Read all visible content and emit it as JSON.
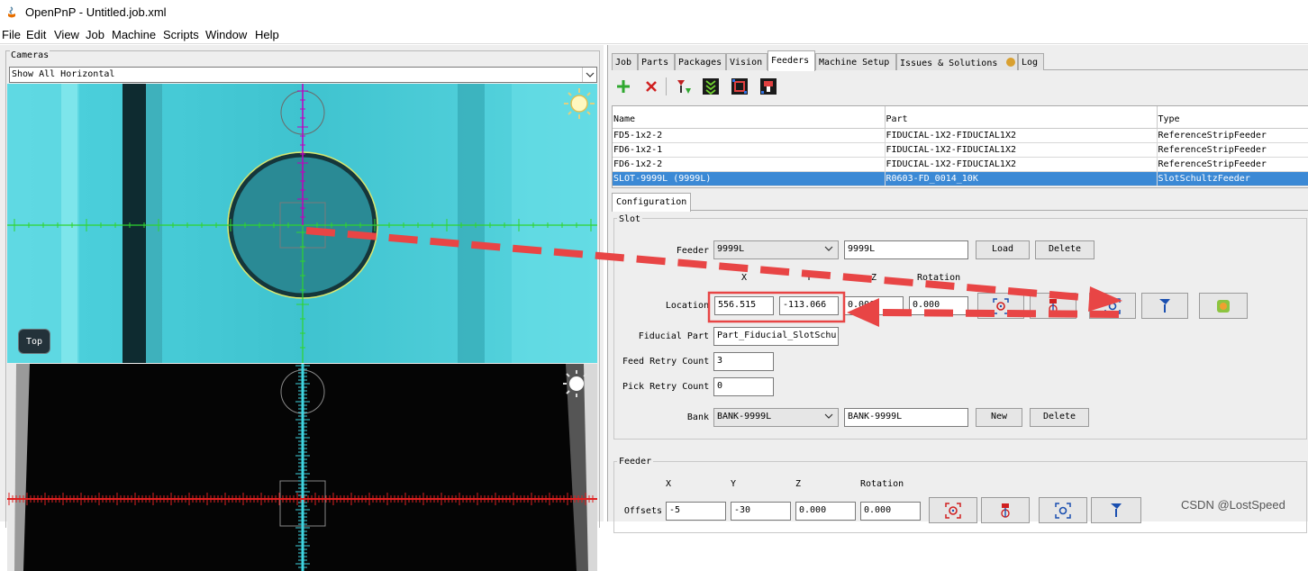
{
  "window": {
    "title": "OpenPnP - Untitled.job.xml"
  },
  "menu": [
    "File",
    "Edit",
    "View",
    "Job",
    "Machine",
    "Scripts",
    "Window",
    "Help"
  ],
  "cameras": {
    "legend": "Cameras",
    "selected": "Show All Horizontal",
    "top_badge": "Top"
  },
  "tabs": [
    "Job",
    "Parts",
    "Packages",
    "Vision",
    "Feeders",
    "Machine Setup",
    "Issues & Solutions",
    "Log"
  ],
  "active_tab": "Feeders",
  "table": {
    "columns": [
      "Name",
      "Part",
      "Type"
    ],
    "rows": [
      [
        "FD5-1x2-2",
        "FIDUCIAL-1X2-FIDUCIAL1X2",
        "ReferenceStripFeeder"
      ],
      [
        "FD6-1x2-1",
        "FIDUCIAL-1X2-FIDUCIAL1X2",
        "ReferenceStripFeeder"
      ],
      [
        "FD6-1x2-2",
        "FIDUCIAL-1X2-FIDUCIAL1X2",
        "ReferenceStripFeeder"
      ],
      [
        "SLOT-9999L (9999L)",
        "R0603-FD_0014_10K",
        "SlotSchultzFeeder"
      ]
    ],
    "selected_row": 3
  },
  "config": {
    "tab": "Configuration",
    "slot": {
      "legend": "Slot",
      "feeder_label": "Feeder",
      "feeder_combo": "9999L",
      "feeder_name": "9999L",
      "load": "Load",
      "delete": "Delete",
      "col_x": "X",
      "col_y": "Y",
      "col_z": "Z",
      "col_rotation": "Rotation",
      "location_label": "Location",
      "loc_x": "556.515",
      "loc_y": "-113.066",
      "loc_z": "0.000",
      "loc_rot": "0.000",
      "fiducial_label": "Fiducial Part",
      "fiducial_value": "Part_Fiducial_SlotSchu",
      "feed_retry_label": "Feed Retry Count",
      "feed_retry_value": "3",
      "pick_retry_label": "Pick Retry Count",
      "pick_retry_value": "0",
      "bank_label": "Bank",
      "bank_combo": "BANK-9999L",
      "bank_name": "BANK-9999L",
      "new": "New",
      "bank_delete": "Delete"
    },
    "feeder": {
      "legend": "Feeder",
      "col_x": "X",
      "col_y": "Y",
      "col_z": "Z",
      "col_rotation": "Rotation",
      "offsets_label": "Offsets",
      "off_x": "-5",
      "off_y": "-30",
      "off_z": "0.000",
      "off_rot": "0.000"
    }
  },
  "watermark": "CSDN @LostSpeed",
  "colors": {
    "selection": "#3b89d5",
    "annotation_red": "#e84545",
    "crosshair_green": "#2fd42f",
    "crosshair_magenta": "#c000c0",
    "camera_cyan": "#3fc9d4"
  }
}
